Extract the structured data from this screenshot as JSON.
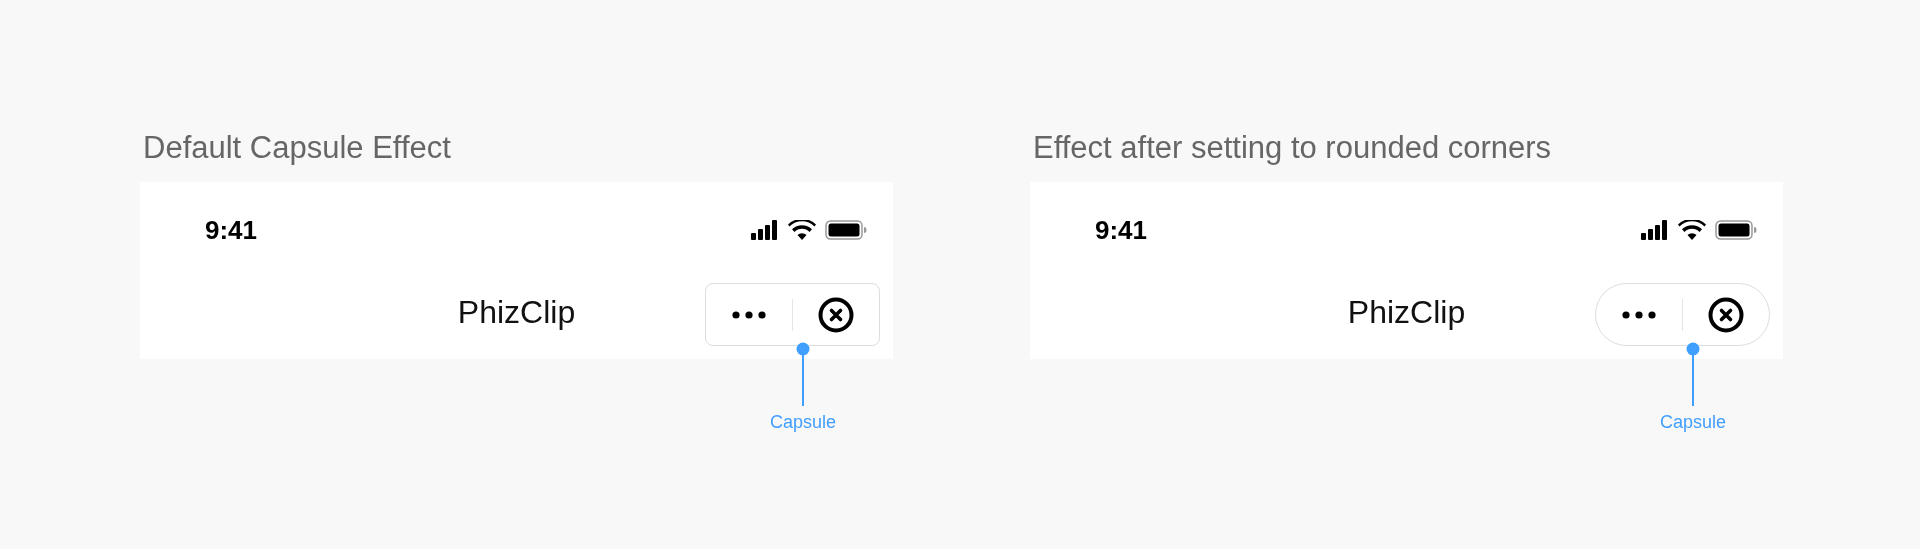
{
  "panels": [
    {
      "caption": "Default Capsule Effect",
      "time": "9:41",
      "title": "PhizClip",
      "capsule": {
        "kind": "default"
      },
      "annotation": "Capsule"
    },
    {
      "caption": "Effect after setting to rounded corners",
      "time": "9:41",
      "title": "PhizClip",
      "capsule": {
        "kind": "rounded"
      },
      "annotation": "Capsule"
    }
  ]
}
